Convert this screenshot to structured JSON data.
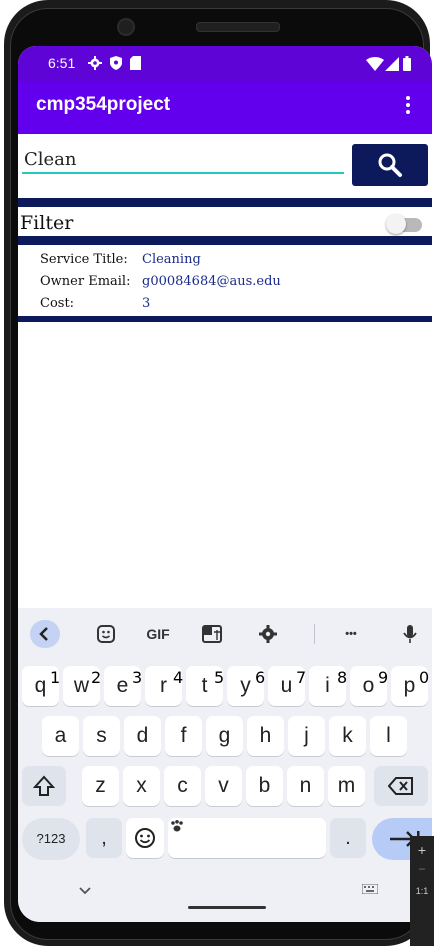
{
  "status": {
    "time": "6:51"
  },
  "app": {
    "title": "cmp354project"
  },
  "search": {
    "value": "Clean"
  },
  "filter": {
    "label": "Filter",
    "enabled": false
  },
  "result": {
    "rows": [
      {
        "label": "Service Title:",
        "value": "Cleaning"
      },
      {
        "label": "Owner Email:",
        "value": "g00084684@aus.edu"
      },
      {
        "label": "Cost:",
        "value": "3"
      }
    ]
  },
  "keyboard": {
    "suggestions": {
      "gif": "GIF",
      "more": "•••"
    },
    "row1": [
      {
        "k": "q",
        "h": "1"
      },
      {
        "k": "w",
        "h": "2"
      },
      {
        "k": "e",
        "h": "3"
      },
      {
        "k": "r",
        "h": "4"
      },
      {
        "k": "t",
        "h": "5"
      },
      {
        "k": "y",
        "h": "6"
      },
      {
        "k": "u",
        "h": "7"
      },
      {
        "k": "i",
        "h": "8"
      },
      {
        "k": "o",
        "h": "9"
      },
      {
        "k": "p",
        "h": "0"
      }
    ],
    "row2": [
      "a",
      "s",
      "d",
      "f",
      "g",
      "h",
      "j",
      "k",
      "l"
    ],
    "row3": [
      "z",
      "x",
      "c",
      "v",
      "b",
      "n",
      "m"
    ],
    "symbols": "?123",
    "comma": ",",
    "period": "."
  },
  "zoom_panel": {
    "plus": "+",
    "minus": "−",
    "ratio": "1:1"
  },
  "colors": {
    "app_bar": "#6200ee",
    "status_bar": "#5e04d6",
    "accent": "#0c1a5c",
    "input_underline": "#25c8c0"
  }
}
